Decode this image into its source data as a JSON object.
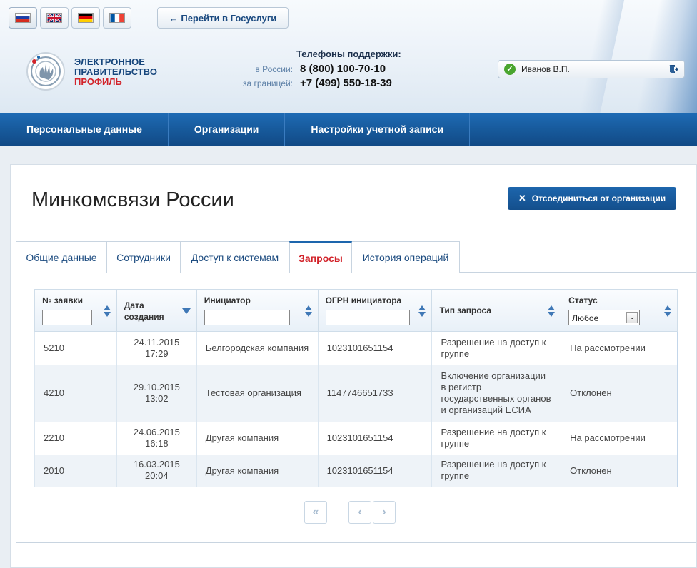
{
  "header": {
    "languages": [
      {
        "name": "ru",
        "active": true
      },
      {
        "name": "en",
        "active": false
      },
      {
        "name": "de",
        "active": false
      },
      {
        "name": "fr",
        "active": false
      }
    ],
    "goto_label": "← Перейти в Госуслуги",
    "logo": {
      "line1": "ЭЛЕКТРОННОЕ",
      "line2": "ПРАВИТЕЛЬСТВО",
      "line3": "ПРОФИЛЬ"
    },
    "support": {
      "title": "Телефоны поддержки:",
      "russia_label": "в России:",
      "russia_phone": "8 (800) 100-70-10",
      "abroad_label": "за границей:",
      "abroad_phone": "+7 (499) 550-18-39"
    },
    "user": {
      "name": "Иванов В.П."
    }
  },
  "nav": {
    "items": [
      "Персональные данные",
      "Организации",
      "Настройки учетной записи"
    ]
  },
  "main": {
    "title": "Минкомсвязи России",
    "disconnect_label": "Отсоединиться от организации",
    "tabs": [
      {
        "label": "Общие данные",
        "active": false
      },
      {
        "label": "Сотрудники",
        "active": false
      },
      {
        "label": "Доступ к системам",
        "active": false
      },
      {
        "label": "Запросы",
        "active": true
      },
      {
        "label": "История операций",
        "active": false
      }
    ]
  },
  "table": {
    "columns": {
      "id": "№ заявки",
      "date": "Дата создания",
      "initiator": "Инициатор",
      "ogrn": "ОГРН инициатора",
      "type": "Тип запроса",
      "status": "Статус"
    },
    "status_filter": "Любое",
    "rows": [
      {
        "id": "5210",
        "date": "24.11.2015 17:29",
        "initiator": "Белгородская компания",
        "ogrn": "1023101651154",
        "type": "Разрешение на доступ к группе",
        "status": "На рассмотрении"
      },
      {
        "id": "4210",
        "date": "29.10.2015 13:02",
        "initiator": "Тестовая организация",
        "ogrn": "1147746651733",
        "type": "Включение организации в регистр государственных органов и организаций ЕСИА",
        "status": "Отклонен"
      },
      {
        "id": "2210",
        "date": "24.06.2015 16:18",
        "initiator": "Другая компания",
        "ogrn": "1023101651154",
        "type": "Разрешение на доступ к группе",
        "status": "На рассмотрении"
      },
      {
        "id": "2010",
        "date": "16.03.2015 20:04",
        "initiator": "Другая компания",
        "ogrn": "1023101651154",
        "type": "Разрешение на доступ к группе",
        "status": "Отклонен"
      }
    ]
  },
  "pager": {
    "first": "«",
    "prev": "‹",
    "next": "›"
  }
}
